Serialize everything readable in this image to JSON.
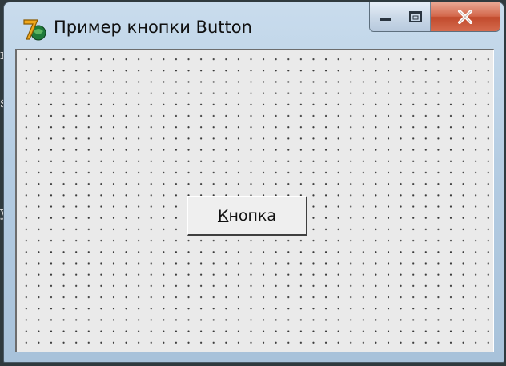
{
  "window": {
    "title": "Пример кнопки Button",
    "colors": {
      "frame": "#b4cce2",
      "client": "#eaeaea",
      "close_button": "#c8553a"
    },
    "app_icon": "delphi-7-icon"
  },
  "caption_buttons": {
    "minimize_icon": "minimize-icon",
    "maximize_icon": "maximize-icon",
    "close_icon": "close-icon"
  },
  "form": {
    "grid": true,
    "button": {
      "accel": "К",
      "rest": "нопка"
    }
  }
}
